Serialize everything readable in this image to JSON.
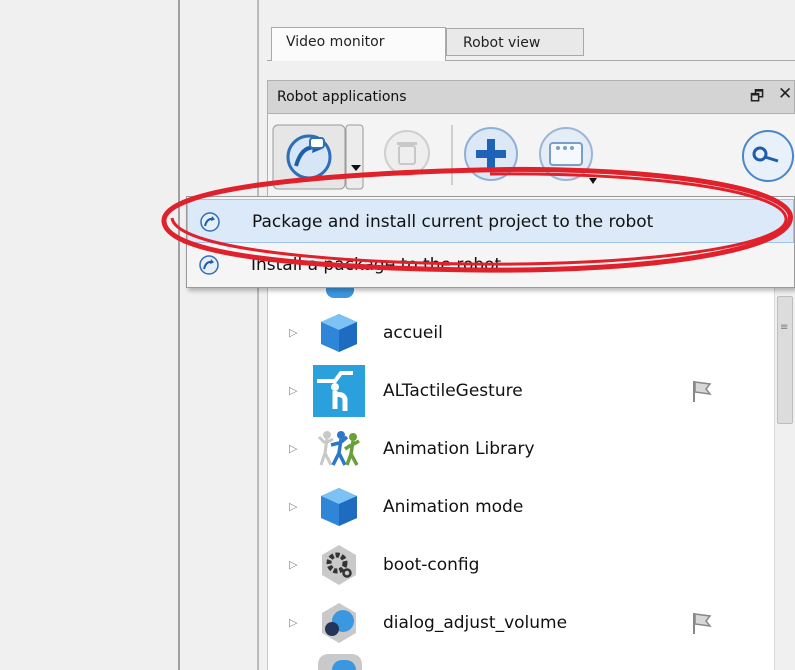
{
  "tabs": [
    {
      "label": "Video monitor",
      "active": true
    },
    {
      "label": "Robot view",
      "active": false
    }
  ],
  "panel": {
    "title": "Robot applications",
    "float_icon": "float-window-icon",
    "close_icon": "close-icon"
  },
  "toolbar": {
    "buttons": [
      "install-to-robot-icon",
      "dropdown-arrow-icon",
      "trash-icon",
      "add-icon",
      "package-dropdown-icon",
      "search-icon"
    ]
  },
  "context_menu": {
    "items": [
      {
        "label": "Package and install current project to the robot",
        "icon": "robot-arrow-icon",
        "highlighted": true
      },
      {
        "label": "Install a package to the robot...",
        "icon": "robot-arrow-icon",
        "highlighted": false
      }
    ],
    "annotation_color": "#e0202a"
  },
  "applications": [
    {
      "name": "accueil",
      "icon": "cube-icon",
      "flag": false
    },
    {
      "name": "ALTactileGesture",
      "icon": "touch-gesture-icon",
      "flag": true
    },
    {
      "name": "Animation Library",
      "icon": "dancers-icon",
      "flag": false
    },
    {
      "name": "Animation mode",
      "icon": "cube-icon",
      "flag": false
    },
    {
      "name": "boot-config",
      "icon": "gear-hexagon-icon",
      "flag": false
    },
    {
      "name": "dialog_adjust_volume",
      "icon": "dialog-bubble-icon",
      "flag": true
    }
  ],
  "colors": {
    "accent_blue": "#2f86d8",
    "highlight": "#dbe9f8"
  }
}
